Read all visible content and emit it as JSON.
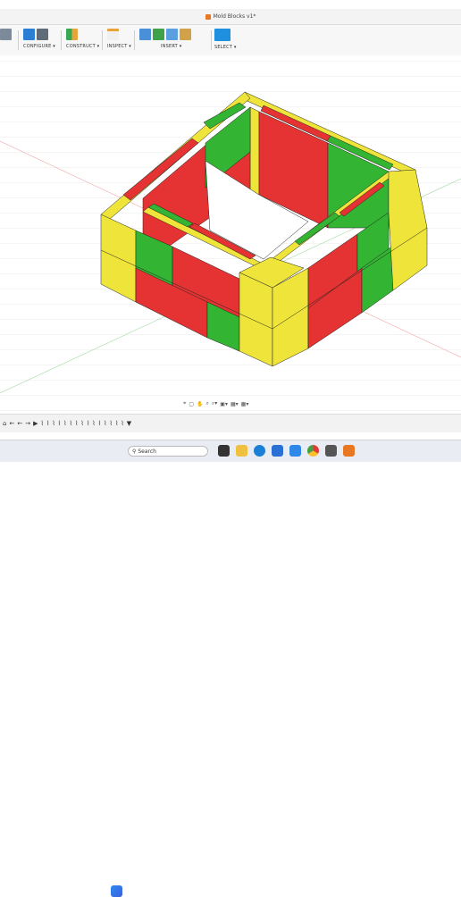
{
  "window": {
    "title": "Mold Blocks v1*"
  },
  "toolbar": {
    "configure": "CONFIGURE ▾",
    "construct": "CONSTRUCT ▾",
    "inspect": "INSPECT ▾",
    "insert": "INSERT ▾",
    "select": "SELECT ▾"
  },
  "navbar": {
    "icons": [
      "⌖",
      "▢",
      "✋",
      "⌕",
      "⌕▾",
      "▣▾",
      "▦▾",
      "▦▾"
    ]
  },
  "timeline": {
    "items": [
      "⌂",
      "←",
      "←",
      "→",
      "▶",
      "⌇",
      "⌇",
      "⌇",
      "⌇",
      "⌇",
      "⌇",
      "⌇",
      "⌇",
      "⌇",
      "⌇",
      "⌇",
      "⌇",
      "⌇",
      "⌇",
      "⌇",
      "▼"
    ]
  },
  "taskbar": {
    "search_placeholder": "Search"
  },
  "colors": {
    "red": "#e53333",
    "green": "#33b433",
    "yellow": "#efe53a",
    "accent": "#1f8fe0"
  }
}
